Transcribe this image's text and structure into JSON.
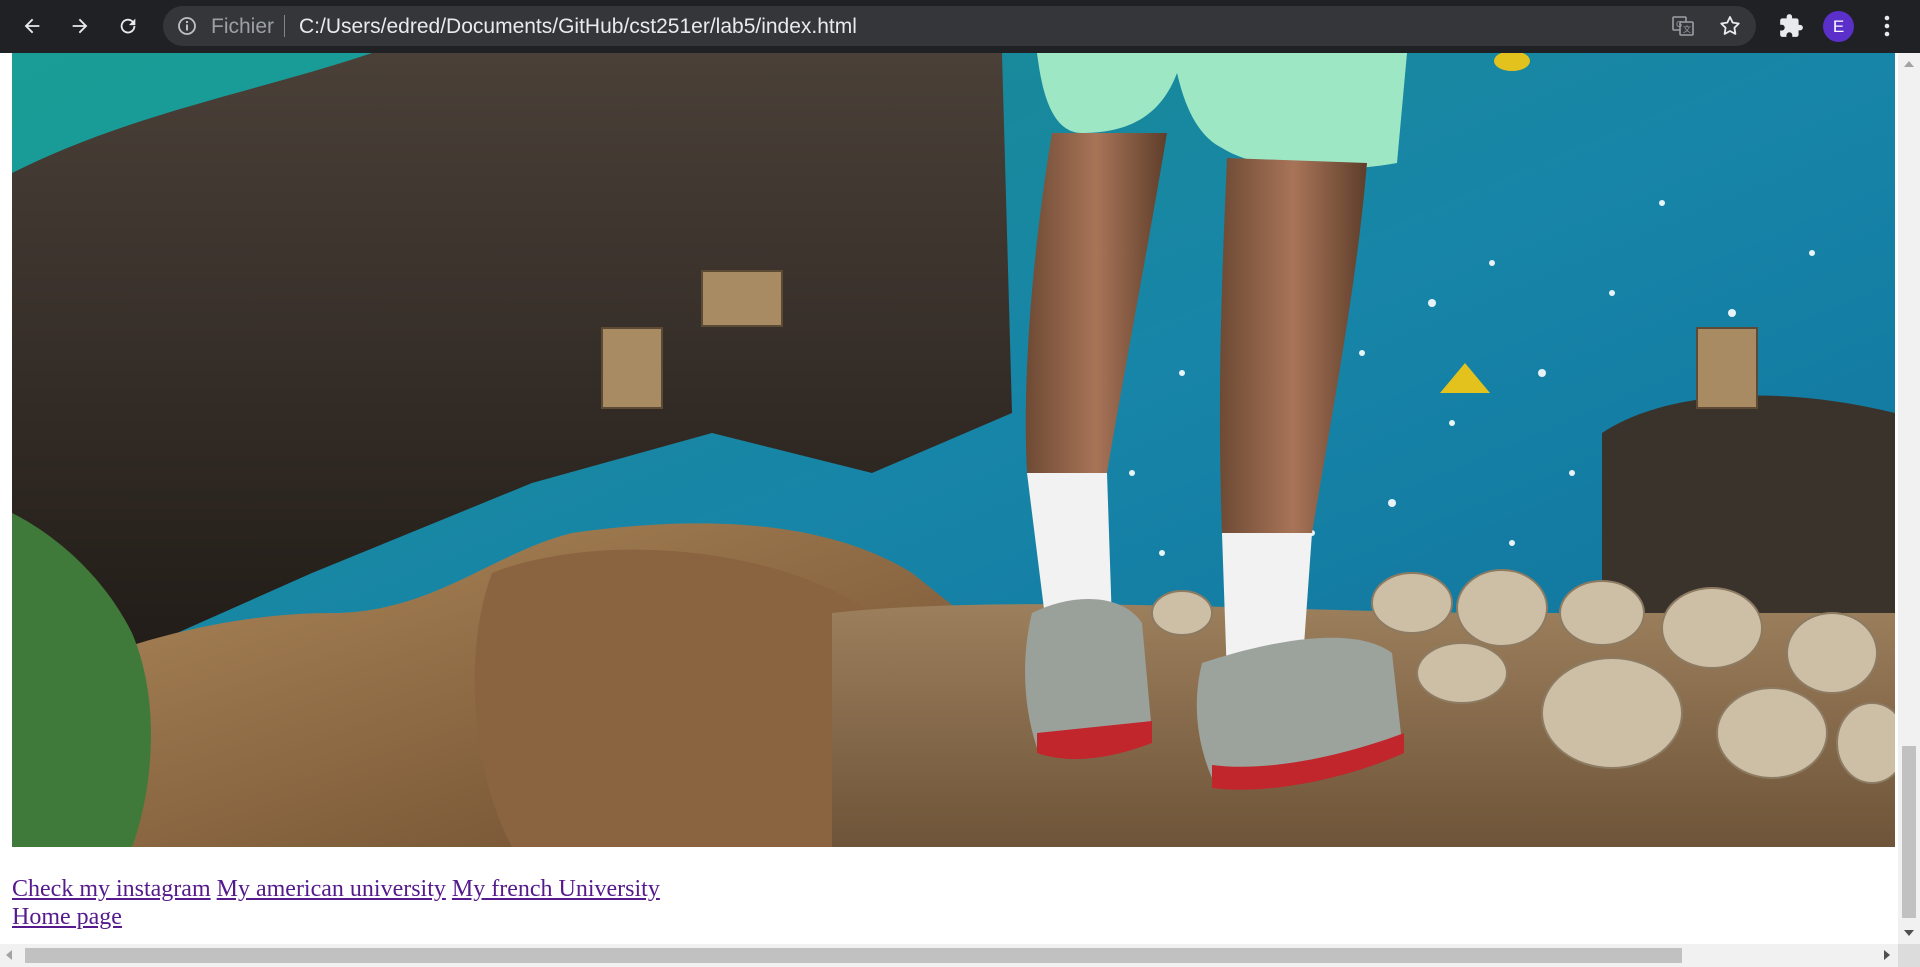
{
  "browser": {
    "address_scheme": "Fichier",
    "address_url": "C:/Users/edred/Documents/GitHub/cst251er/lab5/index.html",
    "profile_initial": "E",
    "profile_color": "#5b2fc9"
  },
  "page": {
    "photo_description_icon": "photo-image",
    "links_row1": [
      {
        "label": "Check my instagram"
      },
      {
        "label": "My american university"
      },
      {
        "label": "My french University"
      }
    ],
    "home_link": "Home page",
    "link_color": "#551a8b"
  },
  "scroll": {
    "vertical_position_fraction": 0.88,
    "horizontal_position_fraction": 0.0
  }
}
